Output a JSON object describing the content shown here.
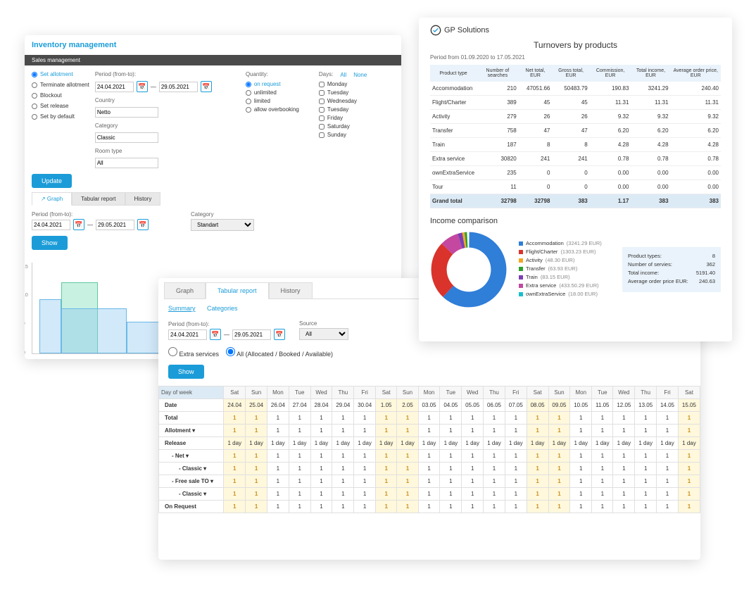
{
  "inv": {
    "title": "Inventory management",
    "bar": "Sales management",
    "radios": [
      "Set allotment",
      "Terminate allotment",
      "Blockout",
      "Set release",
      "Set by default"
    ],
    "period_lbl": "Period (from-to):",
    "from": "24.04.2021",
    "to": "29.05.2021",
    "country_lbl": "Country",
    "country": "Netto",
    "category_lbl": "Category",
    "category": "Classic",
    "roomtype_lbl": "Room type",
    "roomtype": "All",
    "qty_lbl": "Quantity:",
    "qty": [
      "on request",
      "unlimited",
      "limited",
      "allow overbooking"
    ],
    "days_lbl": "Days:",
    "all": "All",
    "none": "None",
    "days": [
      "Monday",
      "Tuesday",
      "Wednesday",
      "Tuesday",
      "Friday",
      "Saturday",
      "Sunday"
    ],
    "update": "Update",
    "tabs": [
      "Graph",
      "Tabular report",
      "History"
    ],
    "cat_sel": "Standart",
    "show": "Show"
  },
  "tabr": {
    "tabs": [
      "Graph",
      "Tabular report",
      "History"
    ],
    "subtabs": [
      "Summary",
      "Categories"
    ],
    "period_lbl": "Period (from-to):",
    "from": "24.04.2021",
    "to": "29.05.2021",
    "source_lbl": "Source",
    "source": "All",
    "extra": "Extra services",
    "all": "All  (Allocated / Booked / Available)",
    "show": "Show",
    "dayhdr": "Day of week",
    "datehdr": "Date",
    "dows": [
      "Sat",
      "Sun",
      "Mon",
      "Tue",
      "Wed",
      "Thu",
      "Fri",
      "Sat",
      "Sun",
      "Mon",
      "Tue",
      "Wed",
      "Thu",
      "Fri",
      "Sat",
      "Sun",
      "Mon",
      "Tue",
      "Wed",
      "Thu",
      "Fri",
      "Sat"
    ],
    "dates": [
      "24.04",
      "25.04",
      "26.04",
      "27.04",
      "28.04",
      "29.04",
      "30.04",
      "1.05",
      "2.05",
      "03.05",
      "04.05",
      "05.05",
      "06.05",
      "07.05",
      "08.05",
      "09.05",
      "10.05",
      "11.05",
      "12.05",
      "13.05",
      "14.05",
      "15.05"
    ],
    "rows": [
      {
        "l": "Total",
        "ones": true
      },
      {
        "l": "Allotment ▾",
        "ones": true
      },
      {
        "l": "Release",
        "rel": true
      },
      {
        "l": "- Net ▾",
        "i": 1,
        "ones": true
      },
      {
        "l": "- Classic ▾",
        "i": 2,
        "ones": true
      },
      {
        "l": "- Free sale TO ▾",
        "i": 1,
        "ones": true
      },
      {
        "l": "- Classic ▾",
        "i": 2,
        "ones": true
      },
      {
        "l": "On Request",
        "ones": true
      }
    ],
    "relval": "1 day"
  },
  "turn": {
    "brand": "GP Solutions",
    "title": "Turnovers by products",
    "period": "Period from 01.09.2020 to 17.05.2021",
    "hdrs": [
      "Product type",
      "Number of searches",
      "Net total, EUR",
      "Gross total, EUR",
      "Commission, EUR",
      "Total income, EUR",
      "Average order price, EUR"
    ],
    "rows": [
      [
        "Accommodation",
        "210",
        "47051.66",
        "50483.79",
        "190.83",
        "3241.29",
        "240.40"
      ],
      [
        "Flight/Charter",
        "389",
        "45",
        "45",
        "11.31",
        "11.31",
        "11.31"
      ],
      [
        "Activity",
        "279",
        "26",
        "26",
        "9.32",
        "9.32",
        "9.32"
      ],
      [
        "Transfer",
        "758",
        "47",
        "47",
        "6.20",
        "6.20",
        "6.20"
      ],
      [
        "Train",
        "187",
        "8",
        "8",
        "4.28",
        "4.28",
        "4.28"
      ],
      [
        "Extra service",
        "30820",
        "241",
        "241",
        "0.78",
        "0.78",
        "0.78"
      ],
      [
        "ownExtraService",
        "235",
        "0",
        "0",
        "0.00",
        "0.00",
        "0.00"
      ],
      [
        "Tour",
        "11",
        "0",
        "0",
        "0.00",
        "0.00",
        "0.00"
      ]
    ],
    "total": [
      "Grand total",
      "32798",
      "32798",
      "383",
      "1.17",
      "383",
      "383"
    ],
    "chart_title": "Income comparison",
    "legend": [
      {
        "c": "#2f7ed8",
        "n": "Accommodation",
        "v": "(3241.29 EUR)"
      },
      {
        "c": "#d9332b",
        "n": "Flight/Charter",
        "v": "(1303.23 EUR)"
      },
      {
        "c": "#f5a623",
        "n": "Activity",
        "v": "(48.30 EUR)"
      },
      {
        "c": "#2ca02c",
        "n": "Transfer",
        "v": "(63.93 EUR)"
      },
      {
        "c": "#7b3fb3",
        "n": "Train",
        "v": "(83.15 EUR)"
      },
      {
        "c": "#c447a0",
        "n": "Extra service",
        "v": "(433.50.29 EUR)"
      },
      {
        "c": "#17becf",
        "n": "ownExtraService",
        "v": "(18.00 EUR)"
      }
    ],
    "summary": [
      [
        "Product types:",
        "8"
      ],
      [
        "Number of servies:",
        "362"
      ],
      [
        "Total income:",
        "5191.40"
      ],
      [
        "Average order price EUR:",
        "240.63"
      ]
    ]
  },
  "chart_data": {
    "type": "pie",
    "title": "Income comparison",
    "series": [
      {
        "name": "Accommodation",
        "value": 3241.29
      },
      {
        "name": "Flight/Charter",
        "value": 1303.23
      },
      {
        "name": "Activity",
        "value": 48.3
      },
      {
        "name": "Transfer",
        "value": 63.93
      },
      {
        "name": "Train",
        "value": 83.15
      },
      {
        "name": "Extra service",
        "value": 433.5
      },
      {
        "name": "ownExtraService",
        "value": 18.0
      }
    ]
  }
}
